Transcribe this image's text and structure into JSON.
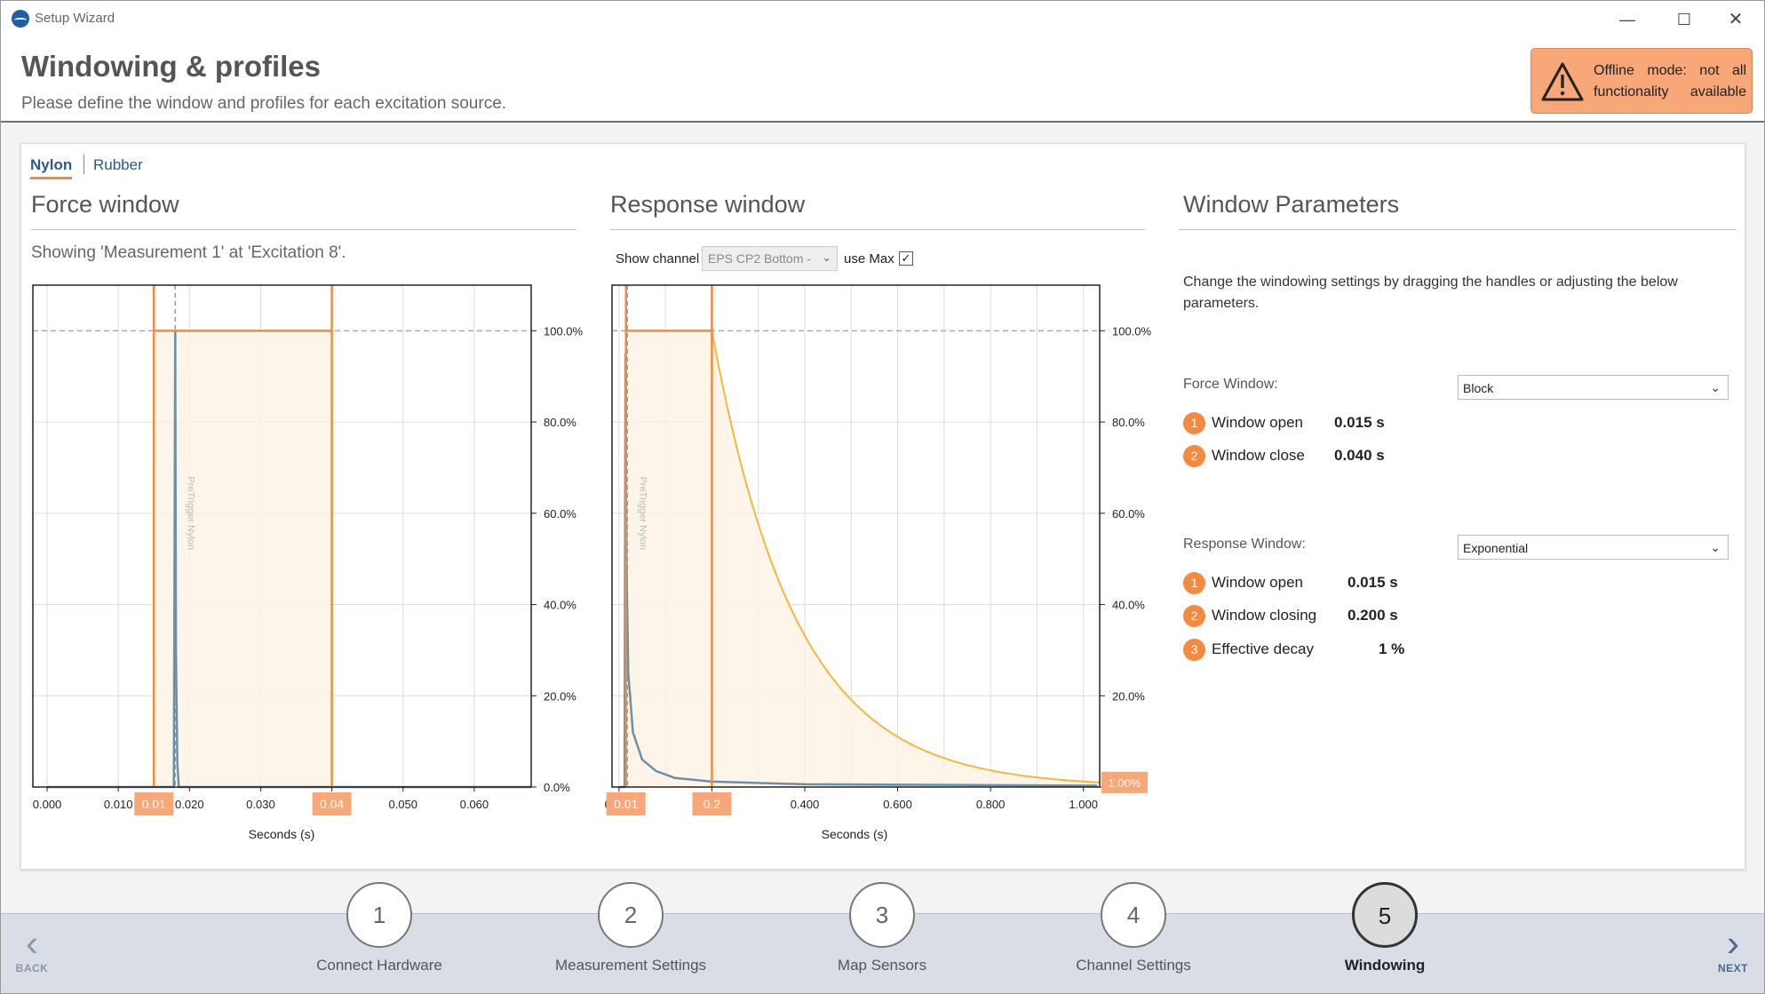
{
  "window": {
    "title": "Setup Wizard",
    "controls": {
      "minimize": "—",
      "maximize": "☐",
      "close": "✕"
    }
  },
  "header": {
    "title": "Windowing & profiles",
    "subtitle": "Please define the window and profiles for each excitation source.",
    "offline_notice": "Offline mode: not all functionality available",
    "offline_color": "#f7a778"
  },
  "tabs": [
    {
      "label": "Nylon",
      "active": true
    },
    {
      "label": "Rubber",
      "active": false
    }
  ],
  "force_window": {
    "title": "Force window",
    "caption": "Showing 'Measurement 1' at 'Excitation 8'.",
    "chart_data": {
      "type": "line",
      "xlabel": "Seconds (s)",
      "ylabel": "",
      "xlim": [
        -0.002,
        0.068
      ],
      "ylim": [
        0,
        1.1
      ],
      "x_ticks": [
        "0.000",
        "0.010",
        "0.020",
        "0.030",
        "0.040",
        "0.050",
        "0.060"
      ],
      "y_ticks": [
        "0.0%",
        "20.0%",
        "40.0%",
        "60.0%",
        "80.0%",
        "100.0%"
      ],
      "pretrigger_label": "PreTrigger Nylon",
      "pretrigger_x": 0.018,
      "window_open": 0.015,
      "window_close": 0.04,
      "handle_labels": [
        "0.01",
        "0.04"
      ],
      "profile": "block",
      "level_pct": 100,
      "signal": {
        "x": [
          0.0,
          0.0178,
          0.018,
          0.0181,
          0.0183,
          0.0185,
          0.068
        ],
        "y": [
          0,
          0,
          1.0,
          0.3,
          0.05,
          0,
          0
        ]
      },
      "colors": {
        "window": "#f28a3f",
        "fill": "#fdf3e3",
        "signal": "#6e8fa8"
      }
    }
  },
  "response_window": {
    "title": "Response window",
    "show_channel_label": "Show channel",
    "channel_value": "EPS CP2 Bottom -",
    "use_max_label": "use Max",
    "use_max_checked": "✓",
    "chart_data": {
      "type": "line",
      "xlabel": "Seconds (s)",
      "ylabel": "",
      "xlim": [
        -0.015,
        1.035
      ],
      "ylim": [
        0,
        1.1
      ],
      "x_ticks": [
        "0.000",
        "0.200",
        "0.400",
        "0.600",
        "0.800",
        "1.000"
      ],
      "y_ticks": [
        "0.0%",
        "20.0%",
        "40.0%",
        "60.0%",
        "80.0%",
        "100.0%"
      ],
      "pretrigger_label": "PreTrigger Nylon",
      "pretrigger_x": 0.018,
      "window_open": 0.015,
      "window_close": 0.2,
      "handle_labels": [
        "0.01",
        "0.2"
      ],
      "end_label": "1.00%",
      "effective_decay": 0.01,
      "profile": "exponential",
      "level_pct": 100,
      "signal": {
        "x": [
          0.0,
          0.012,
          0.014,
          0.016,
          0.02,
          0.03,
          0.05,
          0.08,
          0.12,
          0.2,
          0.4,
          1.03
        ],
        "y": [
          0,
          0,
          0.95,
          0.5,
          0.25,
          0.12,
          0.06,
          0.035,
          0.02,
          0.012,
          0.006,
          0.003
        ]
      },
      "colors": {
        "window": "#f28a3f",
        "fill": "#fdf3e3",
        "decay": "#f4b93a",
        "signal": "#6e8fa8"
      }
    }
  },
  "parameters": {
    "title": "Window Parameters",
    "description": "Change the windowing settings by dragging the handles or adjusting the below parameters.",
    "force": {
      "heading": "Force Window:",
      "type": "Block",
      "rows": [
        {
          "num": "1",
          "label": "Window open",
          "value": "0.015 s"
        },
        {
          "num": "2",
          "label": "Window close",
          "value": "0.040 s"
        }
      ]
    },
    "response": {
      "heading": "Response Window:",
      "type": "Exponential",
      "rows": [
        {
          "num": "1",
          "label": "Window open",
          "value": "0.015 s"
        },
        {
          "num": "2",
          "label": "Window closing",
          "value": "0.200 s"
        },
        {
          "num": "3",
          "label": "Effective decay",
          "value": "1 %"
        }
      ]
    }
  },
  "wizard": {
    "back_label": "BACK",
    "next_label": "NEXT",
    "steps": [
      {
        "num": "1",
        "label": "Connect Hardware",
        "active": false
      },
      {
        "num": "2",
        "label": "Measurement Settings",
        "active": false
      },
      {
        "num": "3",
        "label": "Map Sensors",
        "active": false
      },
      {
        "num": "4",
        "label": "Channel Settings",
        "active": false
      },
      {
        "num": "5",
        "label": "Windowing",
        "active": true
      }
    ]
  }
}
